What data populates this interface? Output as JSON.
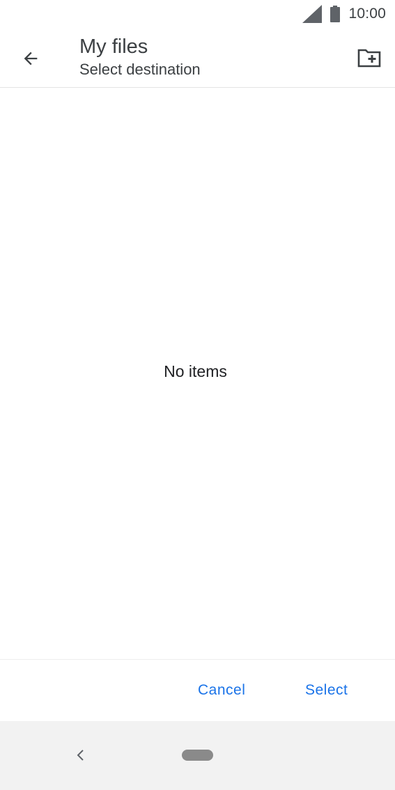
{
  "status_bar": {
    "time": "10:00",
    "icons": [
      "cellular-signal-icon",
      "battery-icon"
    ]
  },
  "app_bar": {
    "title": "My files",
    "subtitle": "Select destination",
    "icons": {
      "back": "arrow-back-icon",
      "new_folder": "create-new-folder-icon"
    }
  },
  "content": {
    "empty_message": "No items"
  },
  "actions": {
    "cancel_label": "Cancel",
    "select_label": "Select"
  },
  "nav_bar": {
    "icons": [
      "nav-back-icon",
      "home-pill-icon"
    ]
  },
  "colors": {
    "accent": "#1a73e8",
    "text_primary": "#202124",
    "text_secondary": "#3c4043",
    "nav_background": "#f2f2f2"
  }
}
